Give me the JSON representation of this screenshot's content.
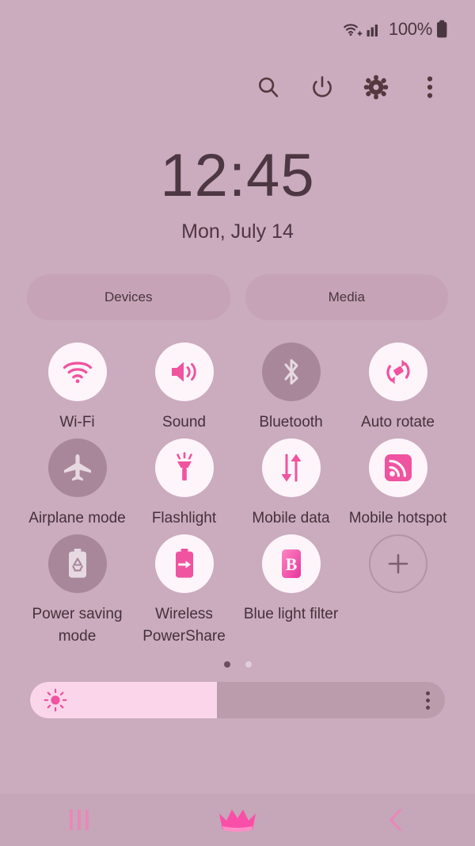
{
  "status_bar": {
    "wifi_icon": "wifi-plus-icon",
    "signal_icon": "cellular-signal-icon",
    "battery_percent": "100%",
    "battery_icon": "battery-full-icon"
  },
  "header_actions": [
    {
      "name": "search",
      "icon": "search-icon",
      "label": "Search"
    },
    {
      "name": "power",
      "icon": "power-icon",
      "label": "Power off"
    },
    {
      "name": "settings",
      "icon": "gear-icon",
      "label": "Settings"
    },
    {
      "name": "more",
      "icon": "more-vertical-icon",
      "label": "More options"
    }
  ],
  "clock": {
    "time": "12:45",
    "date": "Mon, July 14"
  },
  "pills": [
    {
      "label": "Devices"
    },
    {
      "label": "Media"
    }
  ],
  "toggles": [
    {
      "label": "Wi-Fi",
      "icon": "wifi-icon",
      "state": "on"
    },
    {
      "label": "Sound",
      "icon": "sound-icon",
      "state": "on"
    },
    {
      "label": "Bluetooth",
      "icon": "bluetooth-icon",
      "state": "off"
    },
    {
      "label": "Auto rotate",
      "icon": "auto-rotate-icon",
      "state": "on"
    },
    {
      "label": "Airplane mode",
      "icon": "airplane-icon",
      "state": "off"
    },
    {
      "label": "Flashlight",
      "icon": "flashlight-icon",
      "state": "on"
    },
    {
      "label": "Mobile data",
      "icon": "mobile-data-icon",
      "state": "on"
    },
    {
      "label": "Mobile hotspot",
      "icon": "mobile-hotspot-icon",
      "state": "on"
    },
    {
      "label": "Power saving mode",
      "icon": "power-saving-icon",
      "state": "off"
    },
    {
      "label": "Wireless PowerShare",
      "icon": "wireless-powershare-icon",
      "state": "on"
    },
    {
      "label": "Blue light filter",
      "icon": "blue-light-filter-icon",
      "state": "on"
    },
    {
      "label": "",
      "icon": "add-icon",
      "state": "add"
    }
  ],
  "pagination": {
    "total": 2,
    "active": 1
  },
  "brightness": {
    "icon": "brightness-sun-icon",
    "value_percent": 45,
    "menu_icon": "more-vertical-icon"
  },
  "nav_bar": [
    {
      "name": "recents",
      "icon": "recents-icon"
    },
    {
      "name": "home",
      "icon": "crown-home-icon"
    },
    {
      "name": "back",
      "icon": "chevron-left-icon"
    }
  ],
  "colors": {
    "background": "#cbabbe",
    "accent_pink": "#f0539f",
    "text_dark": "#4a3640",
    "toggle_on_bg": "#fdf5fa",
    "toggle_off_bg": "#a8879a",
    "slider_fill": "#fbd6ea",
    "slider_track": "#bb9cad",
    "nav_bar_bg": "#c6a6b9"
  }
}
